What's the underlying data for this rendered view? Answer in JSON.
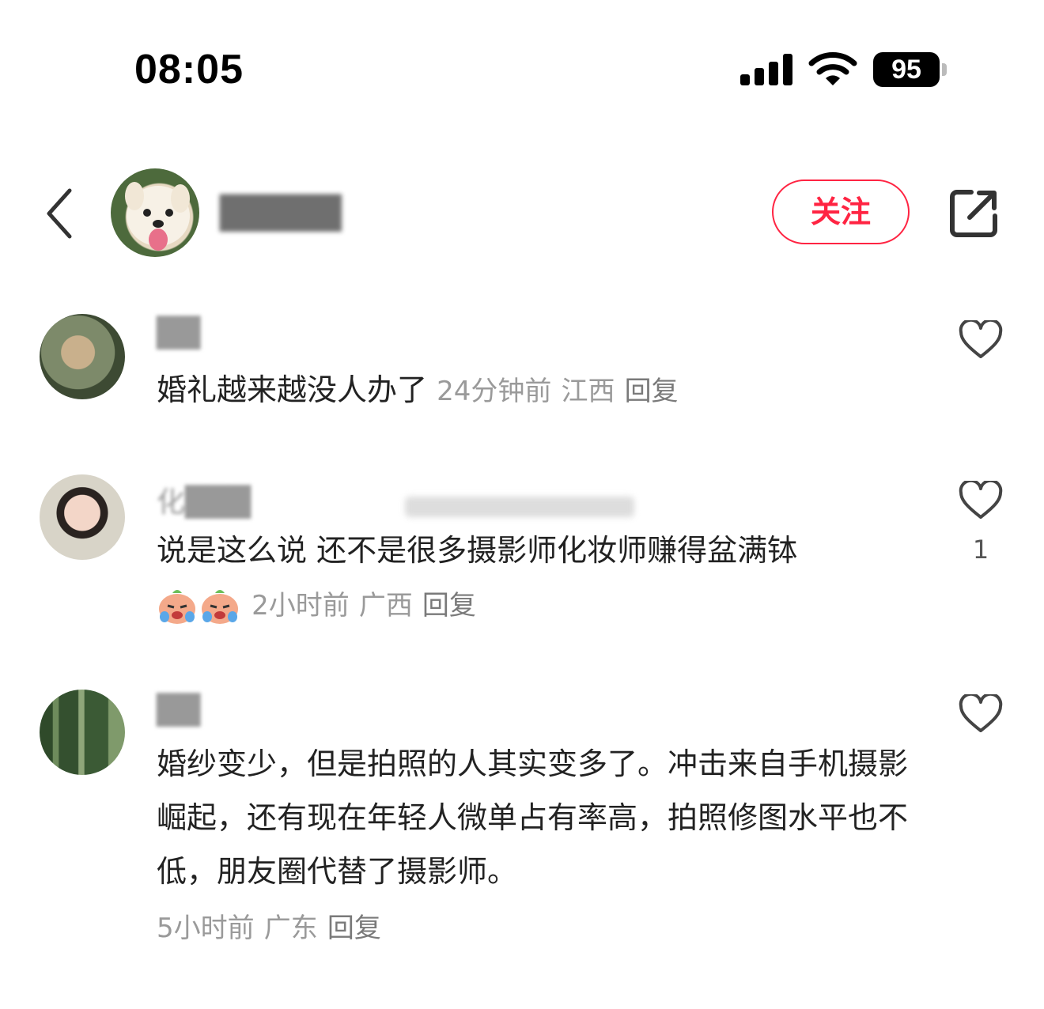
{
  "status_bar": {
    "time": "08:05",
    "battery": "95"
  },
  "header": {
    "author_name": "█████",
    "follow_label": "关注"
  },
  "comments": [
    {
      "username": "██",
      "text": "婚礼越来越没人办了",
      "time": "24分钟前",
      "location": "江西",
      "reply_label": "回复",
      "likes": ""
    },
    {
      "username": "化███",
      "text": "说是这么说  还不是很多摄影师化妆师赚得盆满钵",
      "emojis": [
        "crying-face",
        "crying-face"
      ],
      "time": "2小时前",
      "location": "广西",
      "reply_label": "回复",
      "likes": "1"
    },
    {
      "username": "██",
      "text": "婚纱变少，但是拍照的人其实变多了。冲击来自手机摄影崛起，还有现在年轻人微单占有率高，拍照修图水平也不低，朋友圈代替了摄影师。",
      "time": "5小时前",
      "location": "广东",
      "reply_label": "回复",
      "likes": ""
    }
  ],
  "colors": {
    "accent": "#ff2442",
    "meta": "#9a9a9a",
    "text": "#222222"
  }
}
